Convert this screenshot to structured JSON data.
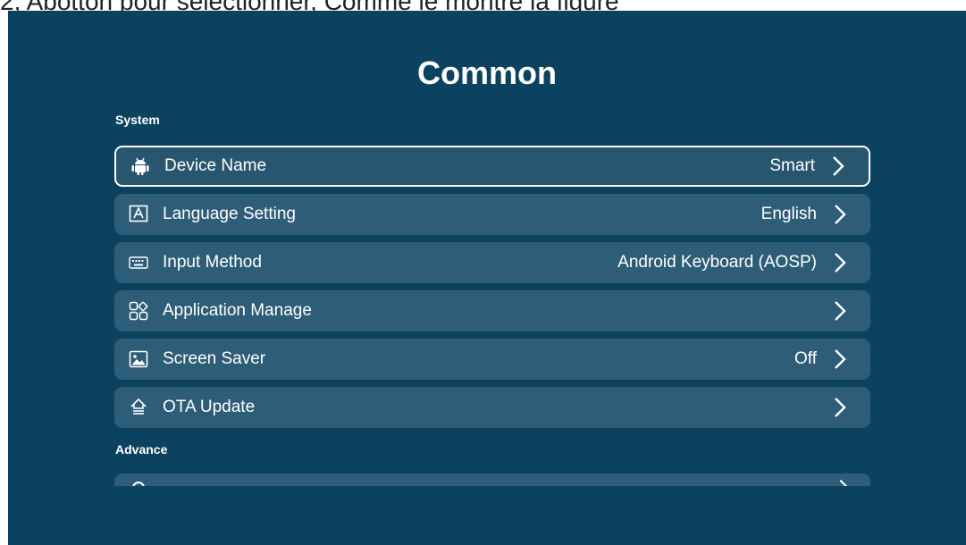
{
  "caption": "2, Abotton pour sélectionner, Comme le montre la figure",
  "screen": {
    "title": "Common",
    "sections": {
      "system": "System",
      "advance": "Advance"
    },
    "items": [
      {
        "label": "Device Name",
        "value": "Smart",
        "icon": "android-icon",
        "focused": true
      },
      {
        "label": "Language Setting",
        "value": "English",
        "icon": "language-icon"
      },
      {
        "label": "Input Method",
        "value": "Android Keyboard (AOSP)",
        "icon": "keyboard-icon"
      },
      {
        "label": "Application Manage",
        "value": "",
        "icon": "apps-grid-icon"
      },
      {
        "label": "Screen Saver",
        "value": "Off",
        "icon": "image-icon"
      },
      {
        "label": "OTA Update",
        "value": "",
        "icon": "update-icon"
      }
    ]
  },
  "colors": {
    "background": "#0b4260",
    "item": "#2e5d78",
    "focus_border": "#ffffff"
  }
}
